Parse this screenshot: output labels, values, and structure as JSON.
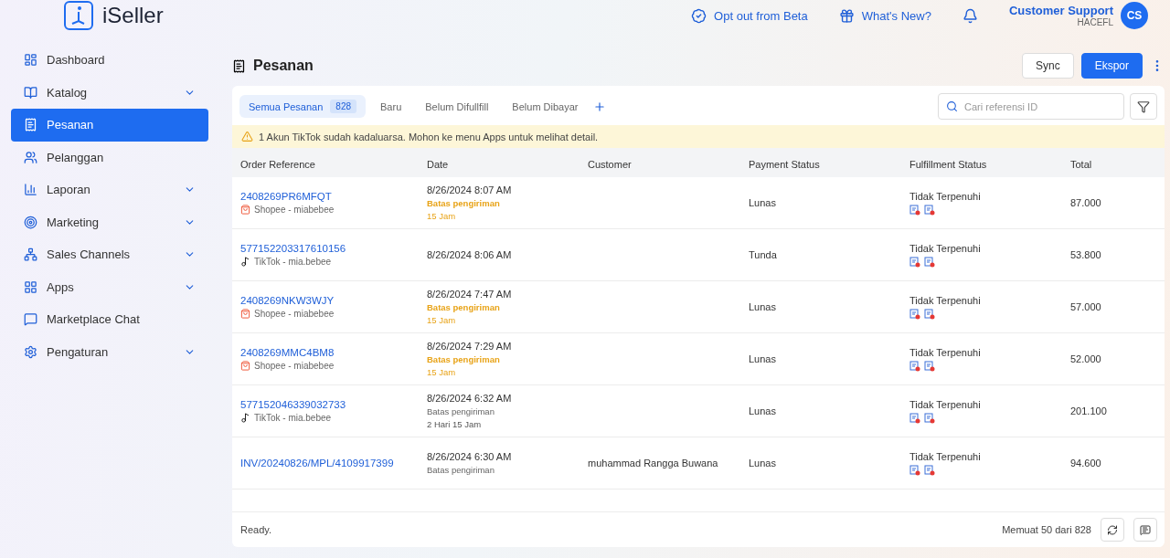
{
  "brand": {
    "name": "iSeller"
  },
  "topbar": {
    "links": [
      {
        "label": "Opt out from Beta"
      },
      {
        "label": "What's New?"
      }
    ],
    "user": {
      "name": "Customer Support",
      "store": "HACEFL",
      "initials": "CS"
    }
  },
  "sidebar": {
    "items": [
      {
        "label": "Dashboard",
        "expandable": false,
        "selected": false
      },
      {
        "label": "Katalog",
        "expandable": true,
        "selected": false
      },
      {
        "label": "Pesanan",
        "expandable": false,
        "selected": true
      },
      {
        "label": "Pelanggan",
        "expandable": false,
        "selected": false
      },
      {
        "label": "Laporan",
        "expandable": true,
        "selected": false
      },
      {
        "label": "Marketing",
        "expandable": true,
        "selected": false
      },
      {
        "label": "Sales Channels",
        "expandable": true,
        "selected": false
      },
      {
        "label": "Apps",
        "expandable": true,
        "selected": false
      },
      {
        "label": "Marketplace Chat",
        "expandable": false,
        "selected": false
      },
      {
        "label": "Pengaturan",
        "expandable": true,
        "selected": false
      }
    ]
  },
  "page": {
    "title": "Pesanan",
    "buttons": [
      {
        "label": "Sync",
        "primary": false
      },
      {
        "label": "Ekspor",
        "primary": true
      }
    ]
  },
  "tabs": [
    {
      "label": "Semua Pesanan",
      "count": "828",
      "selected": true
    },
    {
      "label": "Baru",
      "selected": false
    },
    {
      "label": "Belum Difullfill",
      "selected": false
    },
    {
      "label": "Belum Dibayar",
      "selected": false
    }
  ],
  "search": {
    "placeholder": "Cari referensi ID"
  },
  "warning": "1 Akun TikTok sudah kadaluarsa. Mohon ke menu Apps untuk melihat detail.",
  "table": {
    "columns": [
      "Order Reference",
      "Date",
      "Customer",
      "Payment Status",
      "Fulfillment Status",
      "Total"
    ],
    "rows": [
      {
        "reference": "2408269PR6MFQT",
        "channel": {
          "kind": "shopee",
          "label": "Shopee - miabebee"
        },
        "date": "8/26/2024 8:07 AM",
        "deadline": {
          "label": "Batas pengiriman",
          "time": "15 Jam",
          "urgent": true
        },
        "customer": "",
        "payment": "Lunas",
        "fulfillment": "Tidak Terpenuhi",
        "total": "87.000"
      },
      {
        "reference": "577152203317610156",
        "channel": {
          "kind": "tiktok",
          "label": "TikTok - mia.bebee"
        },
        "date": "8/26/2024 8:06 AM",
        "customer": "",
        "payment": "Tunda",
        "fulfillment": "Tidak Terpenuhi",
        "total": "53.800"
      },
      {
        "reference": "2408269NKW3WJY",
        "channel": {
          "kind": "shopee",
          "label": "Shopee - miabebee"
        },
        "date": "8/26/2024 7:47 AM",
        "deadline": {
          "label": "Batas pengiriman",
          "time": "15 Jam",
          "urgent": true
        },
        "customer": "",
        "payment": "Lunas",
        "fulfillment": "Tidak Terpenuhi",
        "total": "57.000"
      },
      {
        "reference": "2408269MMC4BM8",
        "channel": {
          "kind": "shopee",
          "label": "Shopee - miabebee"
        },
        "date": "8/26/2024 7:29 AM",
        "deadline": {
          "label": "Batas pengiriman",
          "time": "15 Jam",
          "urgent": true
        },
        "customer": "",
        "payment": "Lunas",
        "fulfillment": "Tidak Terpenuhi",
        "total": "52.000"
      },
      {
        "reference": "577152046339032733",
        "channel": {
          "kind": "tiktok",
          "label": "TikTok - mia.bebee"
        },
        "date": "8/26/2024 6:32 AM",
        "deadline": {
          "label": "Batas pengiriman",
          "time": "2 Hari 15 Jam",
          "urgent": false
        },
        "customer": "",
        "payment": "Lunas",
        "fulfillment": "Tidak Terpenuhi",
        "total": "201.100"
      },
      {
        "reference": "INV/20240826/MPL/4109917399",
        "date": "8/26/2024 6:30 AM",
        "deadline": {
          "label": "Batas pengiriman",
          "urgent": false
        },
        "customer": "muhammad Rangga Buwana",
        "payment": "Lunas",
        "fulfillment": "Tidak Terpenuhi",
        "total": "94.600"
      }
    ]
  },
  "footer": {
    "status": "Ready.",
    "loaded": "Memuat 50 dari 828"
  }
}
